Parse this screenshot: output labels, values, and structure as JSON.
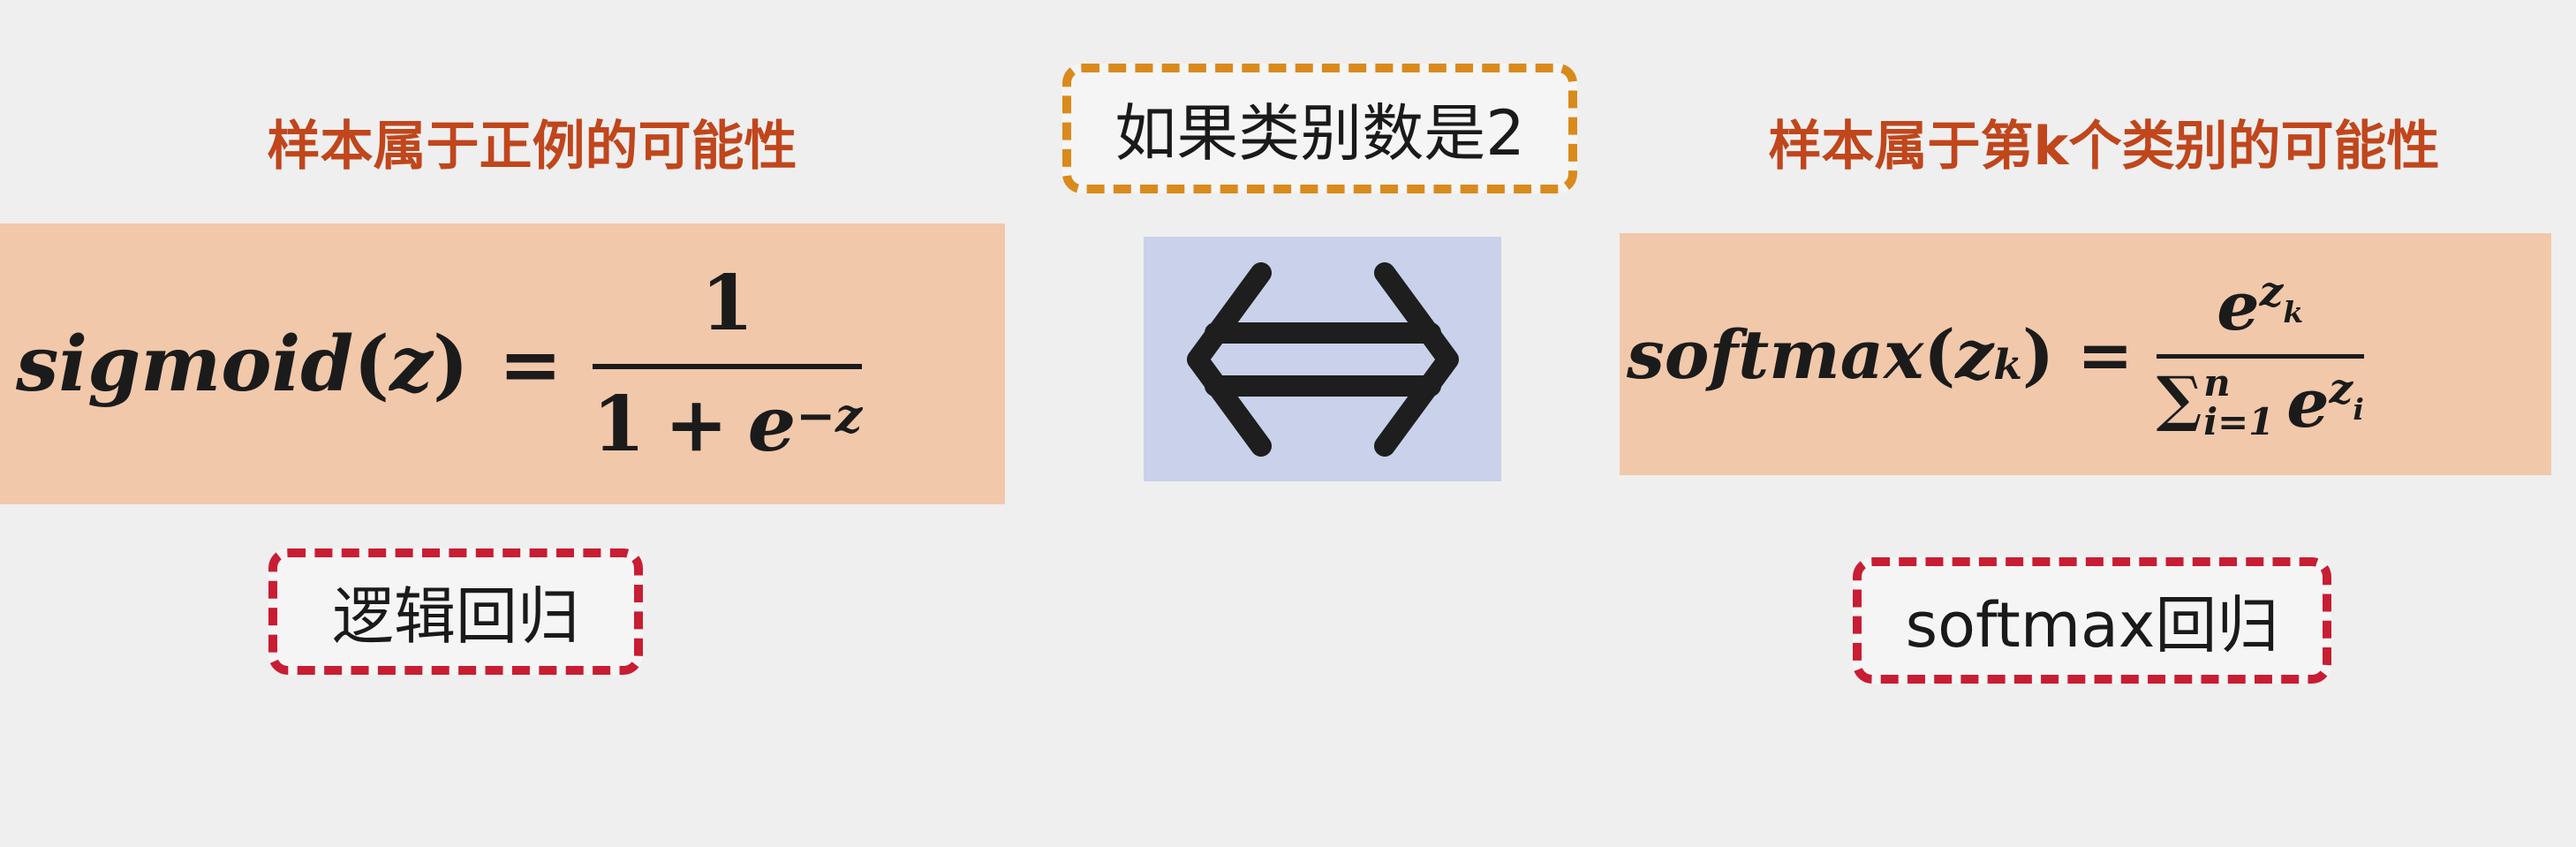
{
  "left": {
    "caption": "样本属于正例的可能性",
    "formula": {
      "func": "sigmoid",
      "arg": "z",
      "equals": "=",
      "numerator": "1",
      "denominator_one": "1",
      "plus": "+",
      "base": "e",
      "exponent": "−z"
    },
    "tag": "逻辑回归"
  },
  "center": {
    "tag": "如果类别数是2",
    "icon": "double-arrow-icon"
  },
  "right": {
    "caption": "样本属于第k个类别的可能性",
    "formula": {
      "func": "softmax",
      "arg": "z",
      "arg_sub": "k",
      "equals": "=",
      "num_base": "e",
      "num_exp": "z",
      "num_exp_sub": "k",
      "sum": "∑",
      "sum_upper": "n",
      "sum_lower": "i=1",
      "den_base": "e",
      "den_exp": "z",
      "den_exp_sub": "i"
    },
    "tag": "softmax回归"
  },
  "colors": {
    "caption": "#c0461c",
    "formula_bg": "#f1c8aa",
    "arrow_bg": "#c9d2ea",
    "orange_dash": "#d98a1d",
    "red_dash": "#c81d33"
  }
}
